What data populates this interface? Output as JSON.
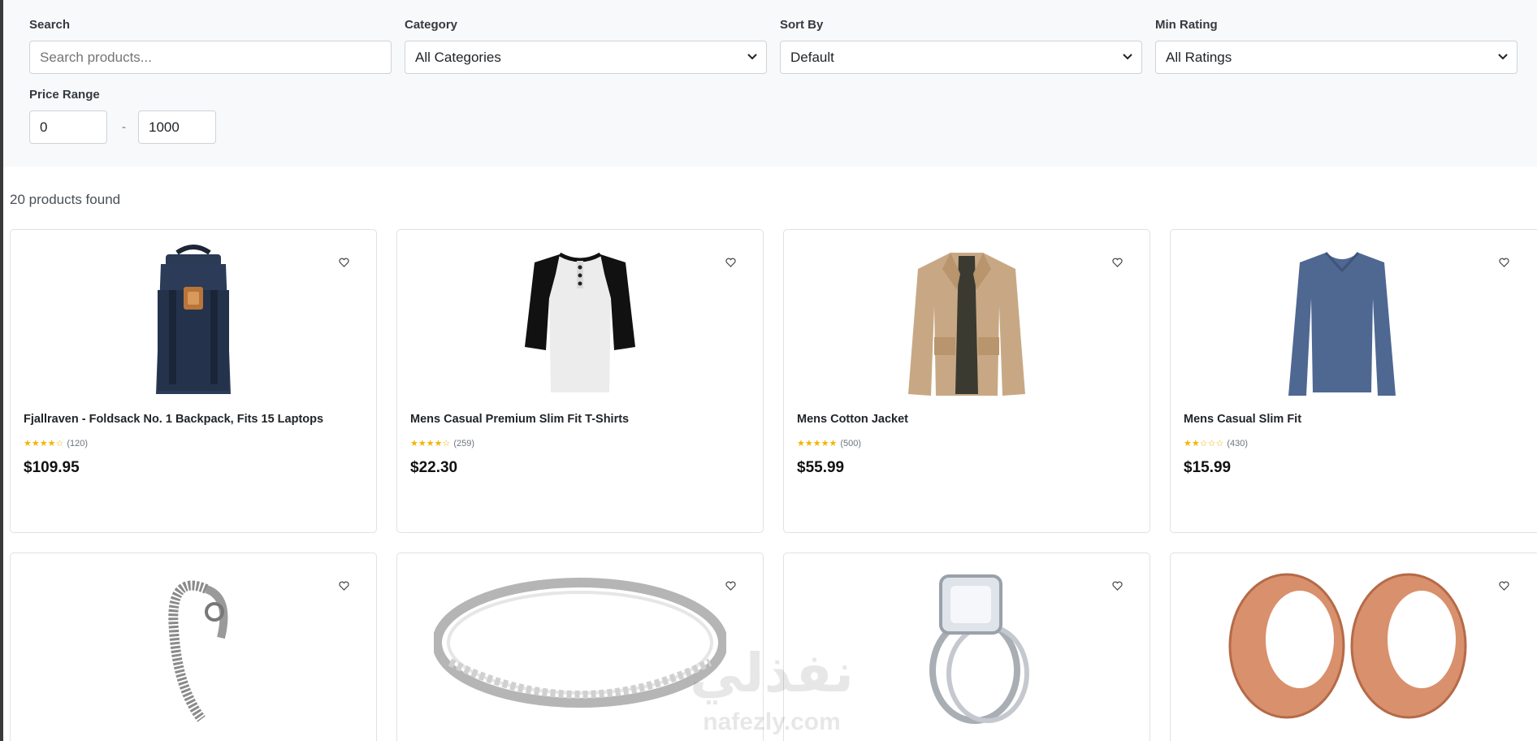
{
  "filters": {
    "search": {
      "label": "Search",
      "value": "",
      "placeholder": "Search products..."
    },
    "category": {
      "label": "Category",
      "selected": "All Categories"
    },
    "sort": {
      "label": "Sort By",
      "selected": "Default"
    },
    "rating": {
      "label": "Min Rating",
      "selected": "All Ratings"
    },
    "price": {
      "label": "Price Range",
      "min": "0",
      "separator": "-",
      "max": "1000"
    }
  },
  "results": {
    "count_text": "20 products found"
  },
  "products": [
    {
      "title": "Fjallraven - Foldsack No. 1 Backpack, Fits 15 Laptops",
      "stars": "★★★★☆",
      "rating": 3.9,
      "reviews": "(120)",
      "price": "$109.95",
      "image": "navy-backpack"
    },
    {
      "title": "Mens Casual Premium Slim Fit T-Shirts",
      "stars": "★★★★☆",
      "rating": 4.1,
      "reviews": "(259)",
      "price": "$22.30",
      "image": "raglan-henley-shirt"
    },
    {
      "title": "Mens Cotton Jacket",
      "stars": "★★★★★",
      "rating": 4.7,
      "reviews": "(500)",
      "price": "$55.99",
      "image": "khaki-jacket"
    },
    {
      "title": "Mens Casual Slim Fit",
      "stars": "★★☆☆☆",
      "rating": 2.1,
      "reviews": "(430)",
      "price": "$15.99",
      "image": "blue-long-sleeve-shirt"
    },
    {
      "title": "",
      "image": "silver-dragon-bracelet"
    },
    {
      "title": "",
      "image": "silver-ring"
    },
    {
      "title": "",
      "image": "diamond-engagement-ring"
    },
    {
      "title": "",
      "image": "rose-gold-tunnel-plugs"
    }
  ],
  "watermark": {
    "arabic": "نفذلي",
    "latin": "nafezly.com"
  },
  "colors": {
    "star": "#f5b301",
    "panel": "#f8f9fa",
    "border": "#dee2e6"
  },
  "icons": {
    "favorite": "heart-outline-icon",
    "select": "chevron-down-icon"
  }
}
